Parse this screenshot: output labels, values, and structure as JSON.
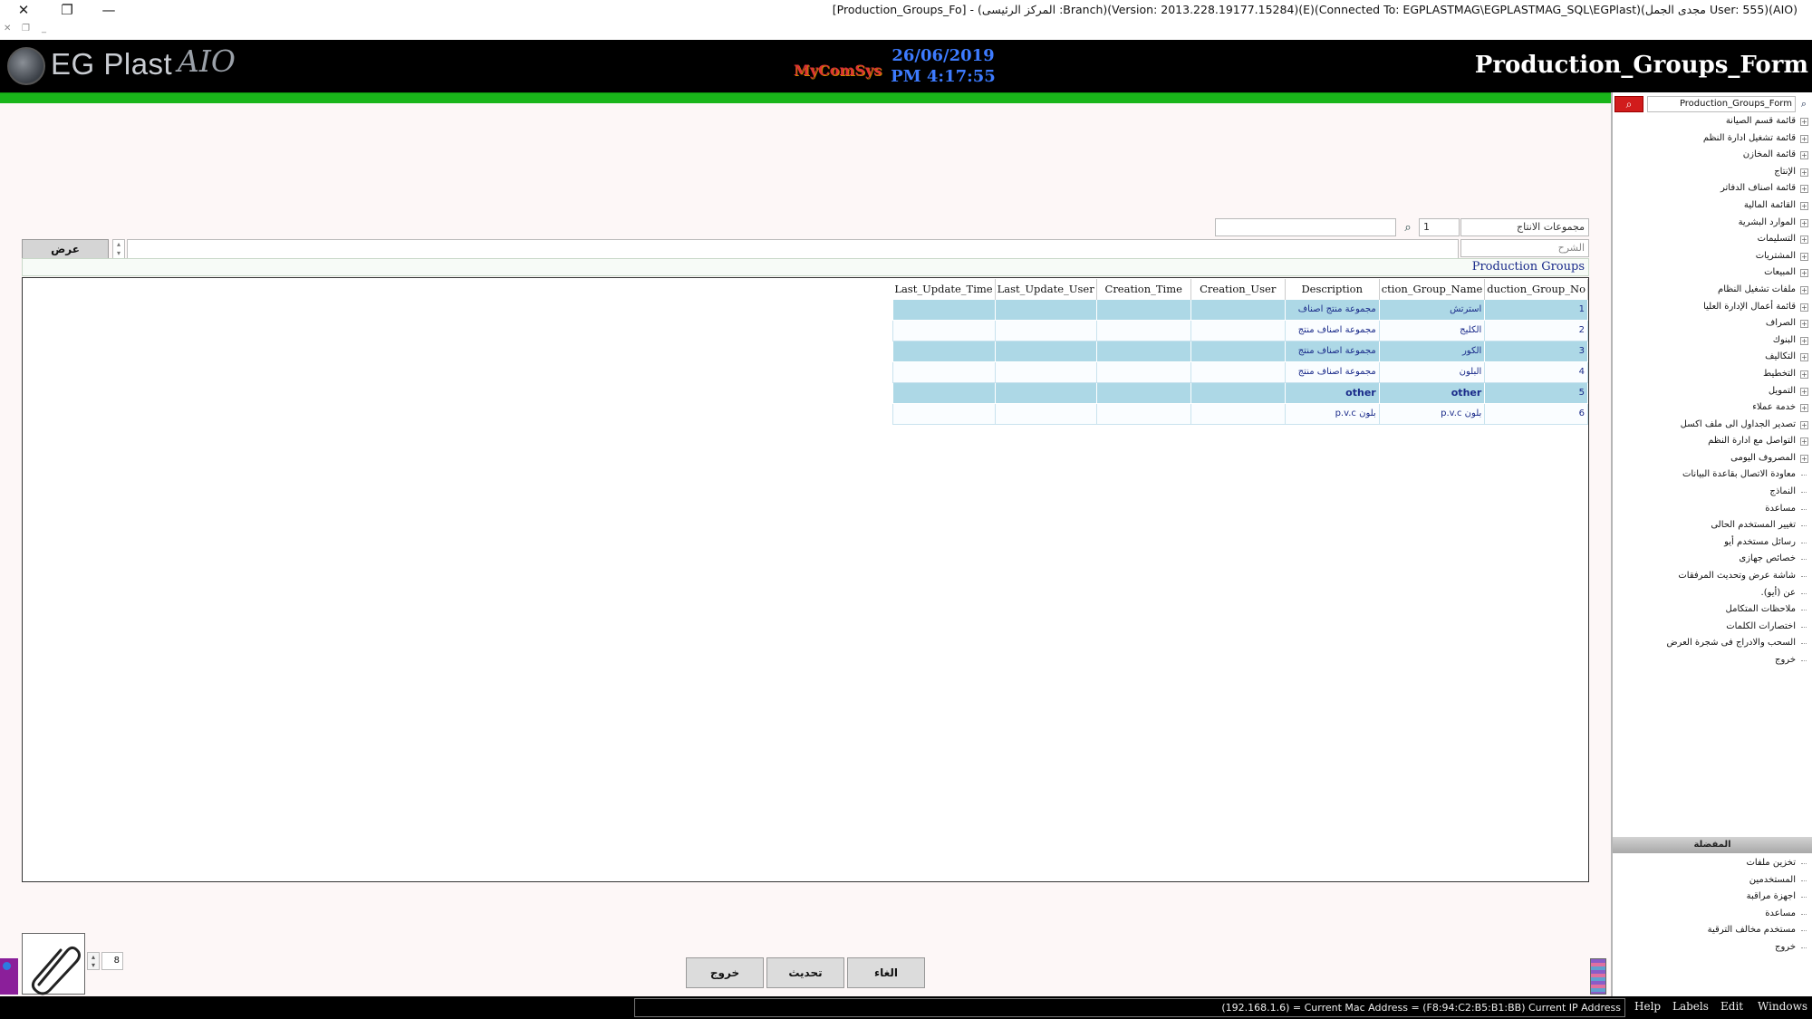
{
  "titlebar": {
    "title": "[Production_Groups_Fo] - (المركز الرئيسى :Branch)(Version: 2013.228.19177.15284)(E)(Connected To: EGPLASTMAG\\EGPLASTMAG_SQL\\EGPlast)(مجدى الجمل User: 555)(AIO)",
    "close_glyph": "✕",
    "restore_glyph": "❐",
    "minimize_glyph": "—"
  },
  "header": {
    "logo_text": "EG Plast",
    "logo_suffix": "AIO",
    "vendor_logo": "MyComSys",
    "date": "26/06/2019",
    "time": "PM 4:17:55",
    "form_title": "Production_Groups_Form"
  },
  "form": {
    "group_field": "مجموعات الانتاج",
    "group_code": "1",
    "search_value": "",
    "description_field": "الشرح",
    "view_button": "عرض",
    "grid_caption": "Production Groups"
  },
  "grid": {
    "columns": [
      "Production_Group_No",
      "Production_Group_Name",
      "Description",
      "Creation_User",
      "Creation_Time",
      "Last_Update_User",
      "Last_Update_Time"
    ],
    "column_display": [
      "duction_Group_No",
      "ction_Group_Name",
      "Description",
      "Creation_User",
      "Creation_Time",
      "Last_Update_User",
      "Last_Update_Time"
    ],
    "rows": [
      {
        "no": "1",
        "name": "استرتش",
        "description": "مجموعة منتج اصناف",
        "creation_user": "",
        "creation_time": "",
        "last_update_user": "",
        "last_update_time": ""
      },
      {
        "no": "2",
        "name": "الكليج",
        "description": "مجموعة اصناف منتج",
        "creation_user": "",
        "creation_time": "",
        "last_update_user": "",
        "last_update_time": ""
      },
      {
        "no": "3",
        "name": "الكور",
        "description": "مجموعة اصناف منتج",
        "creation_user": "",
        "creation_time": "",
        "last_update_user": "",
        "last_update_time": ""
      },
      {
        "no": "4",
        "name": "البلون",
        "description": "مجموعة اصناف منتج",
        "creation_user": "",
        "creation_time": "",
        "last_update_user": "",
        "last_update_time": ""
      },
      {
        "no": "5",
        "name": "other",
        "description": "other",
        "creation_user": "",
        "creation_time": "",
        "last_update_user": "",
        "last_update_time": ""
      },
      {
        "no": "6",
        "name": "بلون p.v.c",
        "description": "بلون p.v.c",
        "creation_user": "",
        "creation_time": "",
        "last_update_user": "",
        "last_update_time": ""
      }
    ]
  },
  "footer": {
    "record_count": "8",
    "exit_button": "خروج",
    "refresh_button": "تحديث",
    "cancel_button": "الغاء"
  },
  "sidebar": {
    "search_value": "Production_Groups_Form",
    "tree_items": [
      {
        "label": "قائمة قسم الصيانة",
        "expandable": true
      },
      {
        "label": "قائمة تشغيل ادارة النظم",
        "expandable": true
      },
      {
        "label": "قائمة المخازن",
        "expandable": true
      },
      {
        "label": "الإنتاج",
        "expandable": true
      },
      {
        "label": "قائمة اصناف الدفاتر",
        "expandable": true
      },
      {
        "label": "القائمة المالية",
        "expandable": true
      },
      {
        "label": "الموارد البشرية",
        "expandable": true
      },
      {
        "label": "التسليمات",
        "expandable": true
      },
      {
        "label": "المشتريات",
        "expandable": true
      },
      {
        "label": "المبيعات",
        "expandable": true
      },
      {
        "label": "ملفات تشغيل النظام",
        "expandable": true
      },
      {
        "label": "قائمة أعمال الإدارة العليا",
        "expandable": true
      },
      {
        "label": "الصراف",
        "expandable": true
      },
      {
        "label": "البنوك",
        "expandable": true
      },
      {
        "label": "التكاليف",
        "expandable": true
      },
      {
        "label": "التخطيط",
        "expandable": true
      },
      {
        "label": "التمويل",
        "expandable": true
      },
      {
        "label": "خدمة عملاء",
        "expandable": true
      },
      {
        "label": "تصدير الجداول الى ملف اكسل",
        "expandable": true
      },
      {
        "label": "التواصل مع ادارة النظم",
        "expandable": true
      },
      {
        "label": "المصروف اليومى",
        "expandable": true
      },
      {
        "label": "معاودة الاتصال بقاعدة البيانات",
        "expandable": false
      },
      {
        "label": "النماذج",
        "expandable": false
      },
      {
        "label": "مساعدة",
        "expandable": false
      },
      {
        "label": "تغيير المستخدم الحالى",
        "expandable": false
      },
      {
        "label": "رسائل مستخدم أيو",
        "expandable": false
      },
      {
        "label": "خصائص جهازى",
        "expandable": false
      },
      {
        "label": "شاشة عرض وتحديث المرفقات",
        "expandable": false
      },
      {
        "label": "عن (أيو).",
        "expandable": false
      },
      {
        "label": "ملاحظات المتكامل",
        "expandable": false
      },
      {
        "label": "اختصارات الكلمات",
        "expandable": false
      },
      {
        "label": "السحب والادراج فى شجرة العرض",
        "expandable": false
      },
      {
        "label": "خروج",
        "expandable": false
      }
    ],
    "favorites_title": "المفضلة",
    "favorites": [
      {
        "label": "تخزين ملفات"
      },
      {
        "label": "المستخدمين"
      },
      {
        "label": "اجهزة مراقبة"
      },
      {
        "label": "مساعدة"
      },
      {
        "label": "مستخدم مخالف الترقية"
      },
      {
        "label": "خروج"
      }
    ]
  },
  "statusbar": {
    "ip_info": "(192.168.1.6) = Current Mac Address = (F8:94:C2:B5:B1:BB) Current IP Address",
    "menu": [
      "Help",
      "Labels",
      "Edit",
      "Windows"
    ]
  }
}
